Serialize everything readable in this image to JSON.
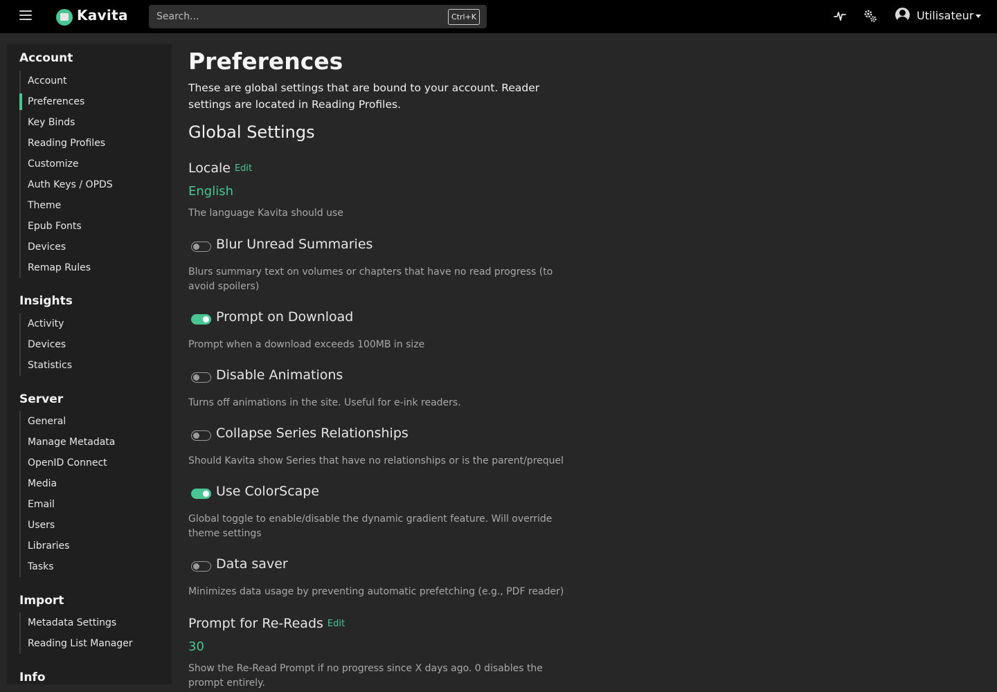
{
  "app": {
    "name": "Kavita",
    "search_placeholder": "Search...",
    "search_shortcut": "Ctrl+K",
    "user_name": "Utilisateur"
  },
  "sidebar": {
    "account": {
      "heading": "Account",
      "items": [
        "Account",
        "Preferences",
        "Key Binds",
        "Reading Profiles",
        "Customize",
        "Auth Keys / OPDS",
        "Theme",
        "Epub Fonts",
        "Devices",
        "Remap Rules"
      ]
    },
    "insights": {
      "heading": "Insights",
      "items": [
        "Activity",
        "Devices",
        "Statistics"
      ]
    },
    "server": {
      "heading": "Server",
      "items": [
        "General",
        "Manage Metadata",
        "OpenID Connect",
        "Media",
        "Email",
        "Users",
        "Libraries",
        "Tasks"
      ]
    },
    "import": {
      "heading": "Import",
      "items": [
        "Metadata Settings",
        "Reading List Manager"
      ]
    },
    "info": {
      "heading": "Info"
    }
  },
  "main": {
    "title": "Preferences",
    "description": "These are global settings that are bound to your account. Reader settings are located in Reading Profiles.",
    "section_title": "Global Settings",
    "edit_label": "Edit",
    "locale": {
      "label": "Locale",
      "value": "English",
      "help": "The language Kavita should use"
    },
    "toggles": [
      {
        "label": "Blur Unread Summaries",
        "on": false,
        "help": "Blurs summary text on volumes or chapters that have no read progress (to avoid spoilers)"
      },
      {
        "label": "Prompt on Download",
        "on": true,
        "help": "Prompt when a download exceeds 100MB in size"
      },
      {
        "label": "Disable Animations",
        "on": false,
        "help": "Turns off animations in the site. Useful for e-ink readers."
      },
      {
        "label": "Collapse Series Relationships",
        "on": false,
        "help": "Should Kavita show Series that have no relationships or is the parent/prequel"
      },
      {
        "label": "Use ColorScape",
        "on": true,
        "help": "Global toggle to enable/disable the dynamic gradient feature. Will override theme settings"
      },
      {
        "label": "Data saver",
        "on": false,
        "help": "Minimizes data usage by preventing automatic prefetching (e.g., PDF reader)"
      }
    ],
    "reread": {
      "label": "Prompt for Re-Reads",
      "value": "30",
      "help": "Show the Re-Read Prompt if no progress since X days ago. 0 disables the prompt entirely."
    }
  },
  "colors": {
    "accent": "#4ac694",
    "background": "#272727",
    "sidebar": "#1f1f1f",
    "topbar": "#000000"
  },
  "icons": {
    "menu": "hamburger-icon",
    "activity": "pulse-icon",
    "admin": "gears-icon",
    "user": "user-circle-icon"
  }
}
